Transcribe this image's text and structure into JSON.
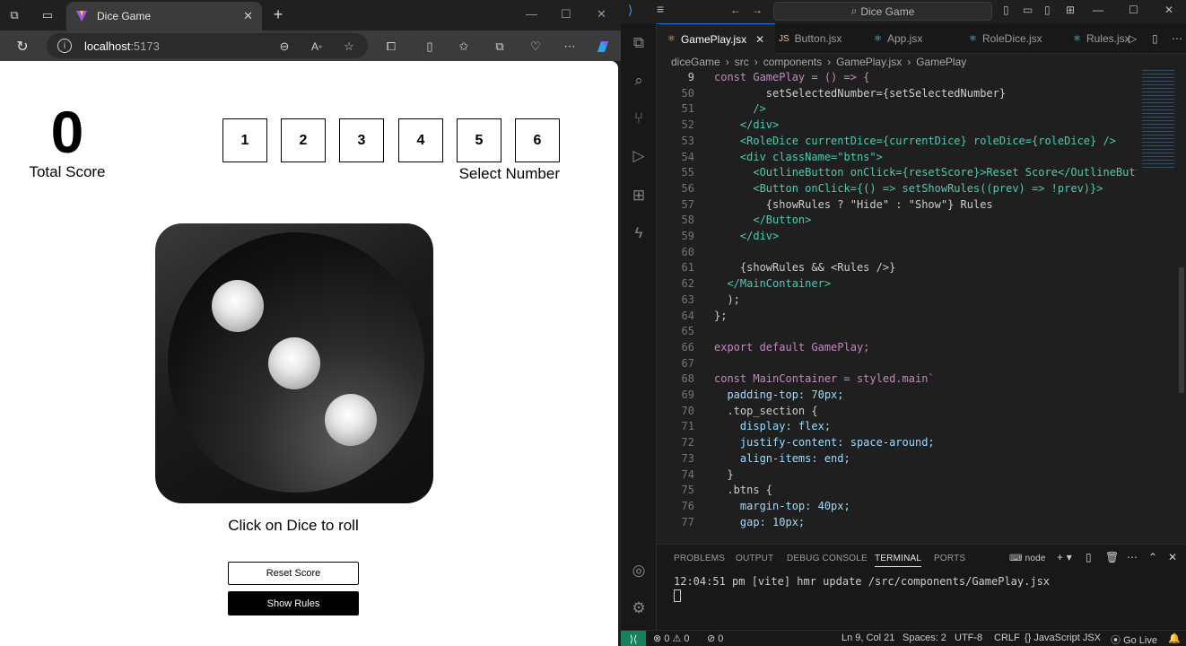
{
  "browser": {
    "tab_title": "Dice Game",
    "url_host": "localhost",
    "url_port": ":5173"
  },
  "game": {
    "total_score": "0",
    "total_score_label": "Total Score",
    "numbers": [
      "1",
      "2",
      "3",
      "4",
      "5",
      "6"
    ],
    "select_label": "Select Number",
    "roll_hint": "Click on Dice to roll",
    "reset_label": "Reset Score",
    "rules_label": "Show Rules",
    "dice_value": 3
  },
  "vscode": {
    "search_text": "Dice Game",
    "tabs": [
      "GamePlay.jsx",
      "Button.jsx",
      "App.jsx",
      "RoleDice.jsx",
      "Rules.jsx"
    ],
    "breadcrumb": [
      "diceGame",
      "src",
      "components",
      "GamePlay.jsx",
      "GamePlay"
    ],
    "code_lines": [
      {
        "n": "9",
        "t": "const GamePlay = () => {"
      },
      {
        "n": "50",
        "t": "        setSelectedNumber={setSelectedNumber}"
      },
      {
        "n": "51",
        "t": "      />"
      },
      {
        "n": "52",
        "t": "    </div>"
      },
      {
        "n": "53",
        "t": "    <RoleDice currentDice={currentDice} roleDice={roleDice} />"
      },
      {
        "n": "54",
        "t": "    <div className=\"btns\">"
      },
      {
        "n": "55",
        "t": "      <OutlineButton onClick={resetScore}>Reset Score</OutlineButton>"
      },
      {
        "n": "56",
        "t": "      <Button onClick={() => setShowRules((prev) => !prev)}>"
      },
      {
        "n": "57",
        "t": "        {showRules ? \"Hide\" : \"Show\"} Rules"
      },
      {
        "n": "58",
        "t": "      </Button>"
      },
      {
        "n": "59",
        "t": "    </div>"
      },
      {
        "n": "60",
        "t": ""
      },
      {
        "n": "61",
        "t": "    {showRules && <Rules />}"
      },
      {
        "n": "62",
        "t": "  </MainContainer>"
      },
      {
        "n": "63",
        "t": "  );"
      },
      {
        "n": "64",
        "t": "};"
      },
      {
        "n": "65",
        "t": ""
      },
      {
        "n": "66",
        "t": "export default GamePlay;"
      },
      {
        "n": "67",
        "t": ""
      },
      {
        "n": "68",
        "t": "const MainContainer = styled.main`"
      },
      {
        "n": "69",
        "t": "  padding-top: 70px;"
      },
      {
        "n": "70",
        "t": "  .top_section {"
      },
      {
        "n": "71",
        "t": "    display: flex;"
      },
      {
        "n": "72",
        "t": "    justify-content: space-around;"
      },
      {
        "n": "73",
        "t": "    align-items: end;"
      },
      {
        "n": "74",
        "t": "  }"
      },
      {
        "n": "75",
        "t": "  .btns {"
      },
      {
        "n": "76",
        "t": "    margin-top: 40px;"
      },
      {
        "n": "77",
        "t": "    gap: 10px;"
      }
    ],
    "panel_tabs": [
      "PROBLEMS",
      "OUTPUT",
      "DEBUG CONSOLE",
      "TERMINAL",
      "PORTS"
    ],
    "terminal_shell": "node",
    "terminal_line": "12:04:51 pm [vite] hmr update /src/components/GamePlay.jsx",
    "status": {
      "errors": "0",
      "warnings": "0",
      "ports": "0",
      "position": "Ln 9, Col 21",
      "spaces": "Spaces: 2",
      "encoding": "UTF-8",
      "eol": "CRLF",
      "language": "JavaScript JSX",
      "golive": "Go Live"
    }
  }
}
